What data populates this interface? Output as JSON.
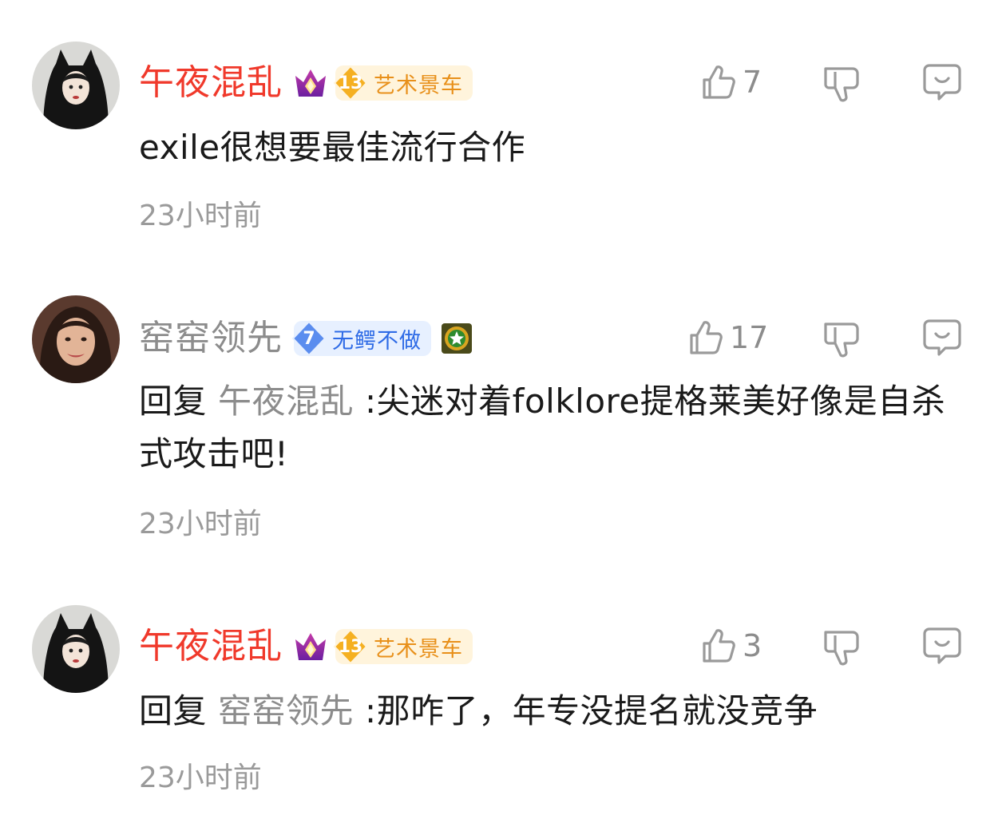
{
  "comments": [
    {
      "username": "午夜混乱",
      "fan_level": "13",
      "fan_name": "艺术景车",
      "likes": "7",
      "text": "exile很想要最佳流行合作",
      "time": "23小时前",
      "name_color": "#f0392b",
      "avatar_icon": "cat-ear-avatar"
    },
    {
      "username": "窑窑领先",
      "fan_level": "7",
      "fan_name": "无鳄不做",
      "likes": "17",
      "reply_word": "回复",
      "reply_target": "午夜混乱",
      "text": ":尖迷对着folklore提格莱美好像是自杀式攻击吧!",
      "time": "23小时前",
      "name_color": "#8c8c8c",
      "avatar_icon": "woman-avatar"
    },
    {
      "username": "午夜混乱",
      "fan_level": "13",
      "fan_name": "艺术景车",
      "likes": "3",
      "reply_word": "回复",
      "reply_target": "窑窑领先",
      "text": ":那咋了，年专没提名就没竞争",
      "time": "23小时前",
      "name_color": "#f0392b",
      "avatar_icon": "cat-ear-avatar"
    }
  ],
  "icons": {
    "like": "thumbs-up-icon",
    "dislike": "thumbs-down-icon",
    "reply": "comment-bubble-icon",
    "vip": "crown-icon",
    "medal": "star-medal-icon"
  },
  "colors": {
    "red_name": "#f0392b",
    "grey_name": "#8c8c8c",
    "gold_badge_text": "#e8901a",
    "blue_badge_text": "#2e6be6"
  }
}
